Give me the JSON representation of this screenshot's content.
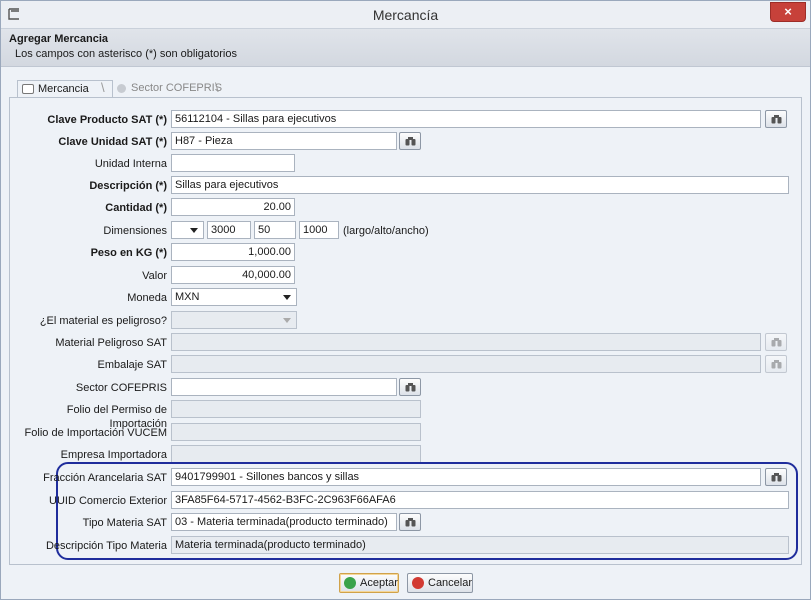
{
  "window": {
    "title": "Mercancía",
    "close_glyph": "×"
  },
  "header": {
    "title": "Agregar Mercancia",
    "subtitle": "Los campos con asterisco (*) son obligatorios"
  },
  "tabs": [
    {
      "label": "Mercancia",
      "icon": "form-icon",
      "active": true
    },
    {
      "label": "Sector COFEPRIS",
      "icon": "circle-icon",
      "active": false
    }
  ],
  "form": {
    "clave_producto": {
      "label": "Clave Producto SAT (*)",
      "value": "56112104 - Sillas para ejecutivos"
    },
    "clave_unidad": {
      "label": "Clave Unidad SAT (*)",
      "value": "H87 - Pieza"
    },
    "unidad_interna": {
      "label": "Unidad Interna",
      "value": ""
    },
    "descripcion": {
      "label": "Descripción (*)",
      "value": "Sillas para ejecutivos"
    },
    "cantidad": {
      "label": "Cantidad (*)",
      "value": "20.00"
    },
    "dimensiones": {
      "label": "Dimensiones",
      "unit": "",
      "largo": "3000",
      "alto": "50",
      "ancho": "1000",
      "hint": "(largo/alto/ancho)"
    },
    "peso": {
      "label": "Peso en KG (*)",
      "value": "1,000.00"
    },
    "valor": {
      "label": "Valor",
      "value": "40,000.00"
    },
    "moneda": {
      "label": "Moneda",
      "value": "MXN"
    },
    "peligroso": {
      "label": "¿El material es peligroso?",
      "value": ""
    },
    "material_peligroso": {
      "label": "Material Peligroso SAT",
      "value": ""
    },
    "embalaje": {
      "label": "Embalaje SAT",
      "value": ""
    },
    "sector_cofepris": {
      "label": "Sector COFEPRIS",
      "value": ""
    },
    "folio_permiso": {
      "label": "Folio del Permiso de Importación",
      "value": ""
    },
    "folio_vucem": {
      "label": "Folio de Importación VUCEM",
      "value": ""
    },
    "empresa_importadora": {
      "label": "Empresa Importadora",
      "value": ""
    },
    "fraccion": {
      "label": "Fracción Arancelaria SAT",
      "value": "9401799901 - Sillones bancos y sillas"
    },
    "uuid": {
      "label": "UUID Comercio Exterior",
      "value": "3FA85F64-5717-4562-B3FC-2C963F66AFA6"
    },
    "tipo_materia": {
      "label": "Tipo Materia SAT",
      "value": "03 - Materia terminada(producto terminado)"
    },
    "desc_tipo_materia": {
      "label": "Descripción Tipo Materia",
      "value": "Materia terminada(producto terminado)"
    }
  },
  "footer": {
    "accept_label": "Aceptar",
    "cancel_label": "Cancelar"
  },
  "colors": {
    "highlight": "#1f2d9c",
    "close": "#c7413a",
    "accept_icon": "#3aa34a",
    "cancel_icon": "#d23a32"
  }
}
